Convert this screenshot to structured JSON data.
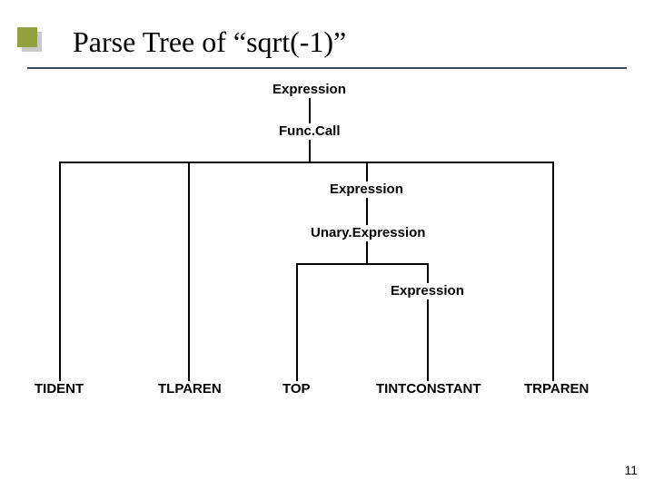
{
  "title": "Parse Tree of “sqrt(-1)”",
  "nodes": {
    "expr1": "Expression",
    "funccall": "Func.Call",
    "expr2": "Expression",
    "unary": "Unary.Expression",
    "expr3": "Expression"
  },
  "leaves": {
    "tident": "TIDENT",
    "tlparen": "TLPAREN",
    "top": "TOP",
    "tint": "TINTCONSTANT",
    "trparen": "TRPAREN"
  },
  "page_number": "11"
}
